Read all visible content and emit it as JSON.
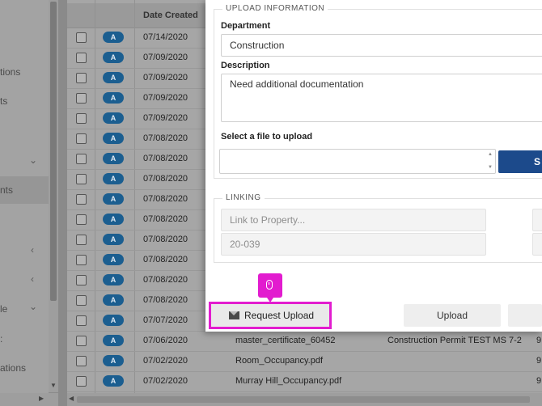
{
  "sidebar": {
    "items": [
      {
        "label": "tions"
      },
      {
        "label": "ts"
      },
      {
        "label": "nts"
      },
      {
        "label": "le"
      },
      {
        "label": ":"
      },
      {
        "label": "ations"
      }
    ]
  },
  "grid": {
    "columns": {
      "date": "Date Created"
    },
    "rows": [
      {
        "badge": "A",
        "date": "07/14/2020",
        "name": "",
        "type": "",
        "extra": ""
      },
      {
        "badge": "A",
        "date": "07/09/2020",
        "name": "",
        "type": "",
        "extra": ""
      },
      {
        "badge": "A",
        "date": "07/09/2020",
        "name": "",
        "type": "",
        "extra": ""
      },
      {
        "badge": "A",
        "date": "07/09/2020",
        "name": "",
        "type": "",
        "extra": ""
      },
      {
        "badge": "A",
        "date": "07/09/2020",
        "name": "",
        "type": "",
        "extra": ""
      },
      {
        "badge": "A",
        "date": "07/08/2020",
        "name": "",
        "type": "",
        "extra": ""
      },
      {
        "badge": "A",
        "date": "07/08/2020",
        "name": "",
        "type": "",
        "extra": ""
      },
      {
        "badge": "A",
        "date": "07/08/2020",
        "name": "",
        "type": "",
        "extra": ""
      },
      {
        "badge": "A",
        "date": "07/08/2020",
        "name": "",
        "type": "",
        "extra": ""
      },
      {
        "badge": "A",
        "date": "07/08/2020",
        "name": "",
        "type": "",
        "extra": ""
      },
      {
        "badge": "A",
        "date": "07/08/2020",
        "name": "",
        "type": "",
        "extra": ""
      },
      {
        "badge": "A",
        "date": "07/08/2020",
        "name": "",
        "type": "",
        "extra": ""
      },
      {
        "badge": "A",
        "date": "07/08/2020",
        "name": "",
        "type": "",
        "extra": ""
      },
      {
        "badge": "A",
        "date": "07/08/2020",
        "name": "",
        "type": "",
        "extra": ""
      },
      {
        "badge": "A",
        "date": "07/07/2020",
        "name": "",
        "type": "",
        "extra": ""
      },
      {
        "badge": "A",
        "date": "07/06/2020",
        "name": "master_certificate_60452",
        "type": "Construction Permit TEST MS 7-2",
        "extra": "9"
      },
      {
        "badge": "A",
        "date": "07/02/2020",
        "name": "Room_Occupancy.pdf",
        "type": "",
        "extra": "9"
      },
      {
        "badge": "A",
        "date": "07/02/2020",
        "name": "Murray Hill_Occupancy.pdf",
        "type": "",
        "extra": "9"
      }
    ]
  },
  "modal": {
    "upload_legend": "UPLOAD INFORMATION",
    "department_label": "Department",
    "department_value": "Construction",
    "description_label": "Description",
    "description_value": "Need additional documentation",
    "file_label": "Select a file to upload",
    "select_button": "S",
    "linking_legend": "LINKING",
    "link_property_placeholder": "Link to Property...",
    "link_value": "20-039",
    "request_upload": "Request Upload",
    "upload": "Upload"
  },
  "icons": {
    "envelope": "envelope-icon",
    "mouse": "mouse-icon"
  },
  "colors": {
    "accent": "#1c4a8b",
    "highlight": "#e21ccf",
    "badge": "#1b5e90"
  }
}
